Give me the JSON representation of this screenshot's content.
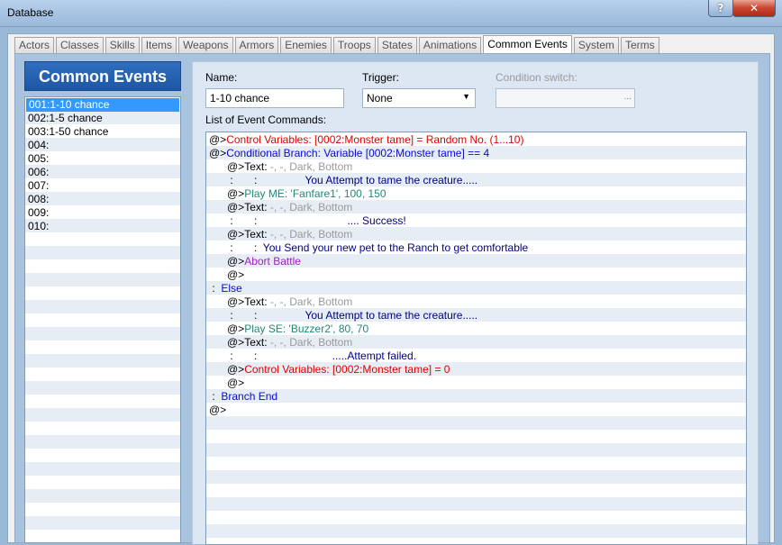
{
  "window": {
    "title": "Database",
    "help_label": "?",
    "close_label": "✕"
  },
  "tabs": [
    {
      "label": "Actors"
    },
    {
      "label": "Classes"
    },
    {
      "label": "Skills"
    },
    {
      "label": "Items"
    },
    {
      "label": "Weapons"
    },
    {
      "label": "Armors"
    },
    {
      "label": "Enemies"
    },
    {
      "label": "Troops"
    },
    {
      "label": "States"
    },
    {
      "label": "Animations"
    },
    {
      "label": "Common Events",
      "active": true
    },
    {
      "label": "System"
    },
    {
      "label": "Terms"
    }
  ],
  "left": {
    "header": "Common Events",
    "items": [
      {
        "label": "001:1-10 chance",
        "selected": true
      },
      {
        "label": "002:1-5 chance"
      },
      {
        "label": "003:1-50 chance"
      },
      {
        "label": "004:"
      },
      {
        "label": "005:"
      },
      {
        "label": "006:"
      },
      {
        "label": "007:"
      },
      {
        "label": "008:"
      },
      {
        "label": "009:"
      },
      {
        "label": "010:"
      }
    ]
  },
  "form": {
    "name_label": "Name:",
    "name_value": "1-10 chance",
    "trigger_label": "Trigger:",
    "trigger_value": "None",
    "condition_label": "Condition switch:",
    "condition_button": "...",
    "commands_label": "List of Event Commands:"
  },
  "commands": [
    {
      "indent": 0,
      "prefix": "@>",
      "text": "Control Variables: [0002:Monster tame] = Random No. (1...10)",
      "color": "red"
    },
    {
      "indent": 0,
      "prefix": "@>",
      "text": "Conditional Branch: Variable [0002:Monster tame] == 4",
      "color": "blue"
    },
    {
      "indent": 1,
      "prefix": "@>",
      "text": "Text: ",
      "suffix": "-, -, Dark, Bottom",
      "color": "black",
      "suffix_color": "gray"
    },
    {
      "indent": 1,
      "prefix": " :       :",
      "text": "                You Attempt to tame the creature.....",
      "color": "darkblue"
    },
    {
      "indent": 1,
      "prefix": "@>",
      "text": "Play ME: 'Fanfare1', 100, 150",
      "color": "teal"
    },
    {
      "indent": 1,
      "prefix": "@>",
      "text": "Text: ",
      "suffix": "-, -, Dark, Bottom",
      "color": "black",
      "suffix_color": "gray"
    },
    {
      "indent": 1,
      "prefix": " :       :",
      "text": "                              .... Success!",
      "color": "darkblue"
    },
    {
      "indent": 1,
      "prefix": "@>",
      "text": "Text: ",
      "suffix": "-, -, Dark, Bottom",
      "color": "black",
      "suffix_color": "gray"
    },
    {
      "indent": 1,
      "prefix": " :       :",
      "text": "  You Send your new pet to the Ranch to get comfortable",
      "color": "darkblue"
    },
    {
      "indent": 1,
      "prefix": "@>",
      "text": "Abort Battle",
      "color": "purple"
    },
    {
      "indent": 1,
      "prefix": "@>",
      "text": "",
      "color": "black"
    },
    {
      "indent": 0,
      "prefix": " :  ",
      "text": "Else",
      "color": "blue"
    },
    {
      "indent": 1,
      "prefix": "@>",
      "text": "Text: ",
      "suffix": "-, -, Dark, Bottom",
      "color": "black",
      "suffix_color": "gray"
    },
    {
      "indent": 1,
      "prefix": " :       :",
      "text": "                You Attempt to tame the creature.....",
      "color": "darkblue"
    },
    {
      "indent": 1,
      "prefix": "@>",
      "text": "Play SE: 'Buzzer2', 80, 70",
      "color": "teal"
    },
    {
      "indent": 1,
      "prefix": "@>",
      "text": "Text: ",
      "suffix": "-, -, Dark, Bottom",
      "color": "black",
      "suffix_color": "gray"
    },
    {
      "indent": 1,
      "prefix": " :       :",
      "text": "                         .....Attempt failed.",
      "color": "darkblue"
    },
    {
      "indent": 1,
      "prefix": "@>",
      "text": "Control Variables: [0002:Monster tame] = 0",
      "color": "red"
    },
    {
      "indent": 1,
      "prefix": "@>",
      "text": "",
      "color": "black"
    },
    {
      "indent": 0,
      "prefix": " :  ",
      "text": "Branch End",
      "color": "blue"
    },
    {
      "indent": 0,
      "prefix": "@>",
      "text": "",
      "color": "black"
    }
  ],
  "colors": {
    "header_blue": "#1e56a4",
    "selection": "#3399ff",
    "command_red": "#e00000",
    "command_blue": "#0a0ad0",
    "command_teal": "#208878",
    "command_purple": "#a020c0"
  },
  "icons": {
    "help": "question-icon",
    "close": "close-icon",
    "dropdown": "chevron-down-icon"
  }
}
